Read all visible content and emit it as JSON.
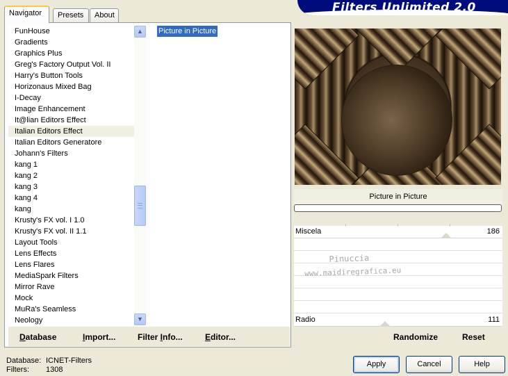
{
  "tabs": [
    "Navigator",
    "Presets",
    "About"
  ],
  "banner": "Filters Unlimited 2.0",
  "categories": [
    "FunHouse",
    "Gradients",
    "Graphics Plus",
    "Greg's Factory Output Vol. II",
    "Harry's Button Tools",
    "Horizonaus Mixed Bag",
    "I-Decay",
    "Image Enhancement",
    "It@lian Editors Effect",
    "Italian Editors Effect",
    "Italian Editors Generatore",
    "Johann's Filters",
    "kang 1",
    "kang 2",
    "kang 3",
    "kang 4",
    "kang",
    "Krusty's FX vol. I 1.0",
    "Krusty's FX vol. II 1.1",
    "Layout Tools",
    "Lens Effects",
    "Lens Flares",
    "MediaSpark Filters",
    "Mirror Rave",
    "Mock",
    "MuRa's Seamless",
    "Neology"
  ],
  "selected_category_index": 9,
  "filters": [
    "Picture in Picture"
  ],
  "toolbar": {
    "database_u": "D",
    "database_rest": "atabase",
    "import_u": "I",
    "import_rest": "mport...",
    "filterinfo_a": "Filter ",
    "filterinfo_u": "I",
    "filterinfo_rest": "nfo...",
    "editor_u": "E",
    "editor_rest": "ditor..."
  },
  "effect_title": "Picture in Picture",
  "sliders": [
    {
      "label": "Miscela",
      "value": "186",
      "level": 186
    },
    {
      "label": "Radio",
      "value": "111",
      "level": 111
    }
  ],
  "watermark": {
    "line1": "Pinuccia",
    "line2": "www.maidiregrafica.eu"
  },
  "randomize_label": "Randomize",
  "reset_label": "Reset",
  "footer": {
    "database_label": "Database:",
    "database_value": "ICNET-Filters",
    "filters_label": "Filters:",
    "filters_value": "1308"
  },
  "buttons": {
    "apply": "Apply",
    "cancel": "Cancel",
    "help": "Help"
  }
}
